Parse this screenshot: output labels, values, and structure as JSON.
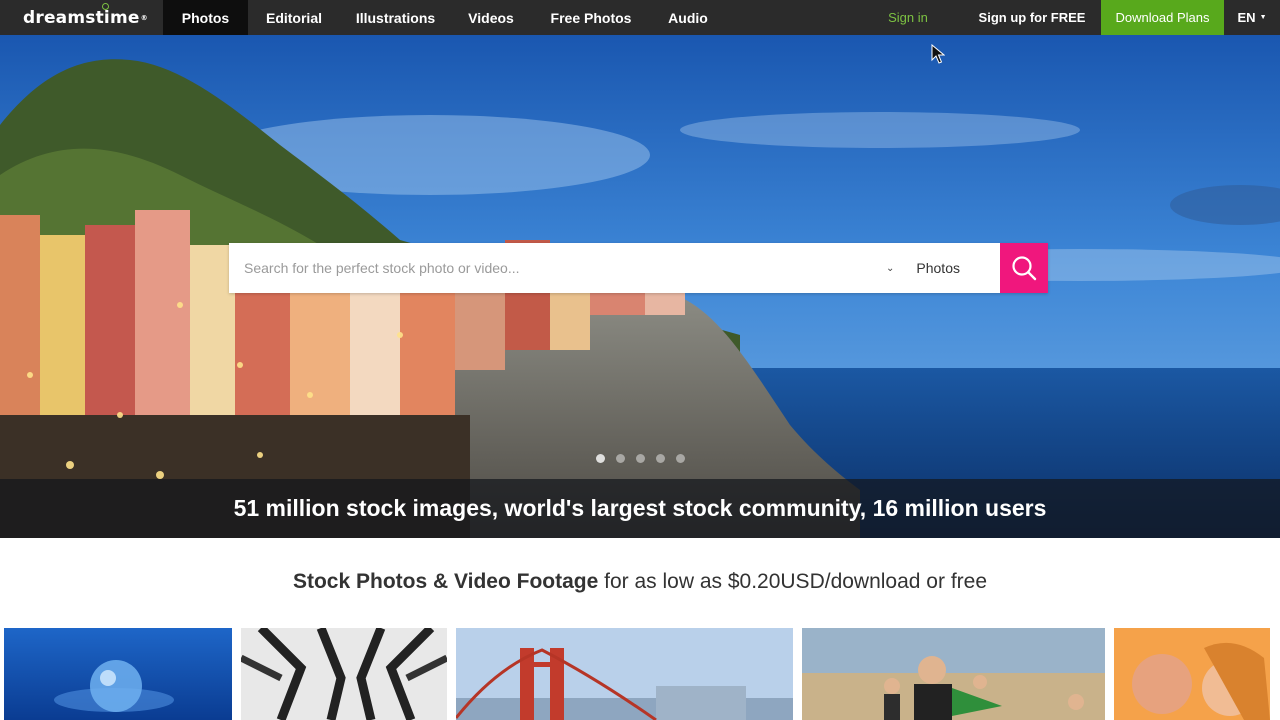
{
  "logo": {
    "text": "dreamstime",
    "reg": "®"
  },
  "nav": {
    "items": [
      {
        "label": "Photos",
        "active": true
      },
      {
        "label": "Editorial",
        "active": false
      },
      {
        "label": "Illustrations",
        "active": false
      },
      {
        "label": "Videos",
        "active": false
      },
      {
        "label": "Free Photos",
        "active": false
      },
      {
        "label": "Audio",
        "active": false
      }
    ]
  },
  "account": {
    "signin": "Sign in",
    "signup": "Sign up for FREE",
    "plans": "Download Plans",
    "lang": "EN"
  },
  "search": {
    "placeholder": "Search for the perfect stock photo or video...",
    "category": "Photos"
  },
  "hero": {
    "slides_total": 5,
    "slide_active": 1,
    "banner": "51 million stock images, world's largest stock community, 16 million users"
  },
  "tagline": {
    "bold": "Stock Photos & Video Footage",
    "rest": " for as low as $0.20USD/download or free"
  },
  "colors": {
    "nav_bg": "#2b2b2b",
    "nav_active": "#0e0e0e",
    "signin": "#7cc142",
    "plans_bg": "#58a91c",
    "search_button": "#f0177d"
  },
  "icons": {
    "search_button": "magnifier-icon",
    "category_toggle": "chevron-down-icon",
    "language_toggle": "caret-down-icon"
  }
}
